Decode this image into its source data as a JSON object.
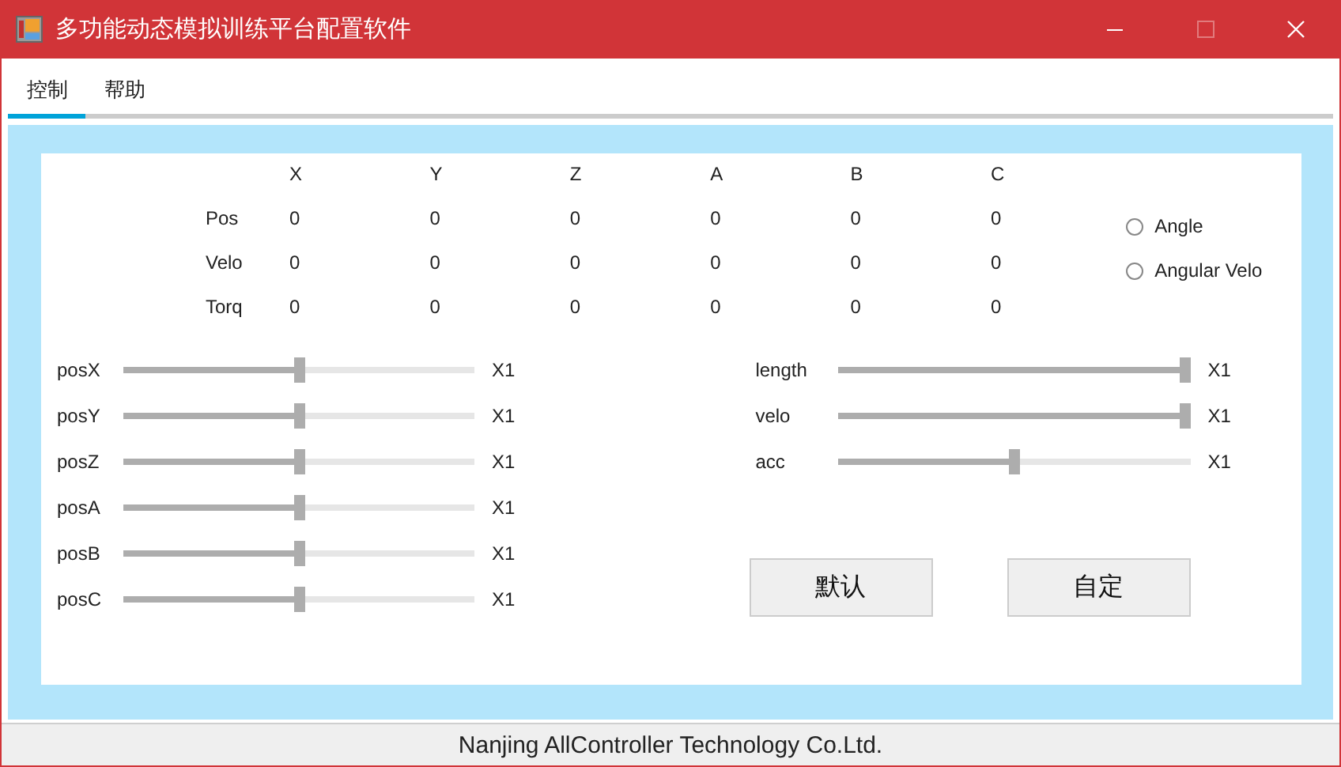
{
  "window": {
    "title": "多功能动态模拟训练平台配置软件",
    "controls": [
      {
        "kind": "minimize",
        "disabled": false
      },
      {
        "kind": "maximize",
        "disabled": true
      },
      {
        "kind": "close",
        "disabled": false
      }
    ]
  },
  "tabs": [
    {
      "label": "控制",
      "selected": true
    },
    {
      "label": "帮助",
      "selected": false
    }
  ],
  "readout": {
    "columns": [
      "X",
      "Y",
      "Z",
      "A",
      "B",
      "C"
    ],
    "rows": [
      {
        "label": "Pos",
        "values": [
          "0",
          "0",
          "0",
          "0",
          "0",
          "0"
        ]
      },
      {
        "label": "Velo",
        "values": [
          "0",
          "0",
          "0",
          "0",
          "0",
          "0"
        ]
      },
      {
        "label": "Torq",
        "values": [
          "0",
          "0",
          "0",
          "0",
          "0",
          "0"
        ]
      }
    ]
  },
  "modes": [
    {
      "label": "Angle",
      "selected": false
    },
    {
      "label": "Angular Velo",
      "selected": false
    }
  ],
  "sliders_left": [
    {
      "label": "posX",
      "level": 0.5,
      "scale": "X1"
    },
    {
      "label": "posY",
      "level": 0.5,
      "scale": "X1"
    },
    {
      "label": "posZ",
      "level": 0.5,
      "scale": "X1"
    },
    {
      "label": "posA",
      "level": 0.5,
      "scale": "X1"
    },
    {
      "label": "posB",
      "level": 0.5,
      "scale": "X1"
    },
    {
      "label": "posC",
      "level": 0.5,
      "scale": "X1"
    }
  ],
  "sliders_right": [
    {
      "label": "length",
      "level": 1,
      "scale": "X1"
    },
    {
      "label": "velo",
      "level": 1,
      "scale": "X1"
    },
    {
      "label": "acc",
      "level": 0.5,
      "scale": "X1"
    }
  ],
  "buttons": [
    "默认",
    "自定"
  ],
  "status_bar": "Nanjing AllController Technology Co.Ltd."
}
